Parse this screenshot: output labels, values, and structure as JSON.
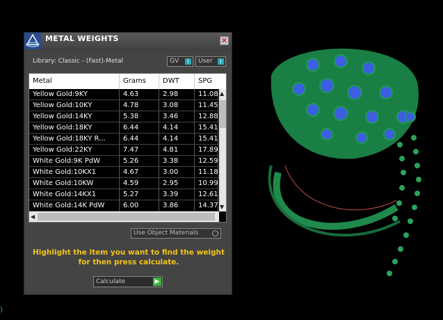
{
  "panel": {
    "title": "METAL WEIGHTS",
    "close_label": "✕",
    "library": "Library: Classic - (Fast)-Metal",
    "gv_label": "GV",
    "user_label": "User",
    "toggle_mark": "I"
  },
  "table": {
    "columns": [
      "Metal",
      "Grams",
      "DWT",
      "SPG"
    ],
    "rows": [
      [
        "Yellow Gold:9KY",
        "4.63",
        "2.98",
        "11.08"
      ],
      [
        "Yellow Gold:10KY",
        "4.78",
        "3.08",
        "11.45"
      ],
      [
        "Yellow Gold:14KY",
        "5.38",
        "3.46",
        "12.88"
      ],
      [
        "Yellow Gold:18KY",
        "6.44",
        "4.14",
        "15.41"
      ],
      [
        "Yellow Gold:18KY R...",
        "6.44",
        "4.14",
        "15.41"
      ],
      [
        "Yellow Gold:22KY",
        "7.47",
        "4.81",
        "17.89"
      ],
      [
        "White Gold:9K PdW",
        "5.26",
        "3.38",
        "12.59"
      ],
      [
        "White Gold:10KX1",
        "4.67",
        "3.00",
        "11.18"
      ],
      [
        "White Gold:10KW",
        "4.59",
        "2.95",
        "10.99"
      ],
      [
        "White Gold:14KX1",
        "5.27",
        "3.39",
        "12.61"
      ],
      [
        "White Gold:14K PdW",
        "6.00",
        "3.86",
        "14.37"
      ]
    ]
  },
  "options": {
    "use_object_materials": "Use Object Materials"
  },
  "message": "Highlight the item you want to find the weight for then press calculate.",
  "calculate": {
    "label": "Calculate",
    "go_icon": "▶"
  },
  "colors": {
    "accent_teal": "#2aa9b8",
    "message_yellow": "#f2c219",
    "ring_green": "#1f8a4c",
    "gem_blue": "#3b5fe0"
  }
}
